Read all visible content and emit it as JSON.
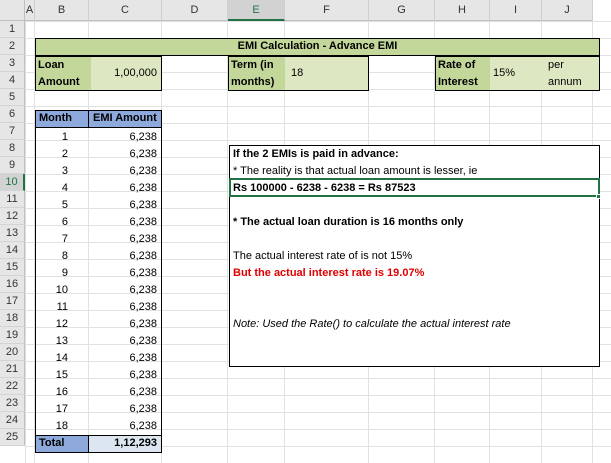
{
  "columns": [
    "A",
    "B",
    "C",
    "D",
    "E",
    "F",
    "G",
    "H",
    "I",
    "J"
  ],
  "rows": [
    "1",
    "2",
    "3",
    "4",
    "5",
    "6",
    "7",
    "8",
    "9",
    "10",
    "11",
    "12",
    "13",
    "14",
    "15",
    "16",
    "17",
    "18",
    "19",
    "20",
    "21",
    "22",
    "23",
    "24",
    "25"
  ],
  "title": "EMI Calculation - Advance EMI",
  "loan": {
    "label1": "Loan",
    "label2": "Amount",
    "value": "1,00,000"
  },
  "term": {
    "label1": "Term (in",
    "label2": "months)",
    "value": "18"
  },
  "rate": {
    "label1": "Rate of",
    "label2": "Interest",
    "value": "15%",
    "unit1": "per",
    "unit2": "annum"
  },
  "table": {
    "header_month": "Month",
    "header_emi": "EMI Amount",
    "rows": [
      {
        "m": "1",
        "v": "6,238"
      },
      {
        "m": "2",
        "v": "6,238"
      },
      {
        "m": "3",
        "v": "6,238"
      },
      {
        "m": "4",
        "v": "6,238"
      },
      {
        "m": "5",
        "v": "6,238"
      },
      {
        "m": "6",
        "v": "6,238"
      },
      {
        "m": "7",
        "v": "6,238"
      },
      {
        "m": "8",
        "v": "6,238"
      },
      {
        "m": "9",
        "v": "6,238"
      },
      {
        "m": "10",
        "v": "6,238"
      },
      {
        "m": "11",
        "v": "6,238"
      },
      {
        "m": "12",
        "v": "6,238"
      },
      {
        "m": "13",
        "v": "6,238"
      },
      {
        "m": "14",
        "v": "6,238"
      },
      {
        "m": "15",
        "v": "6,238"
      },
      {
        "m": "16",
        "v": "6,238"
      },
      {
        "m": "17",
        "v": "6,238"
      },
      {
        "m": "18",
        "v": "6,238"
      }
    ],
    "total_label": "Total",
    "total_value": "1,12,293"
  },
  "note": {
    "l1": "If the 2 EMIs is paid in advance:",
    "l2": "* The reality is that actual loan amount is lesser, ie",
    "l3": "Rs 100000 - 6238 - 6238 = Rs 87523",
    "l4": "* The actual loan duration is 16 months only",
    "l5": "The actual interest rate of is not 15%",
    "l6": "But the actual interest rate is 19.07%",
    "l7": "Note: Used the Rate() to calculate the actual interest rate"
  },
  "colors": {
    "green": "#c4d79b",
    "blue": "#8ea9db",
    "lightblue": "#dce6f1",
    "red": "#e00000",
    "selection": "#217346"
  }
}
